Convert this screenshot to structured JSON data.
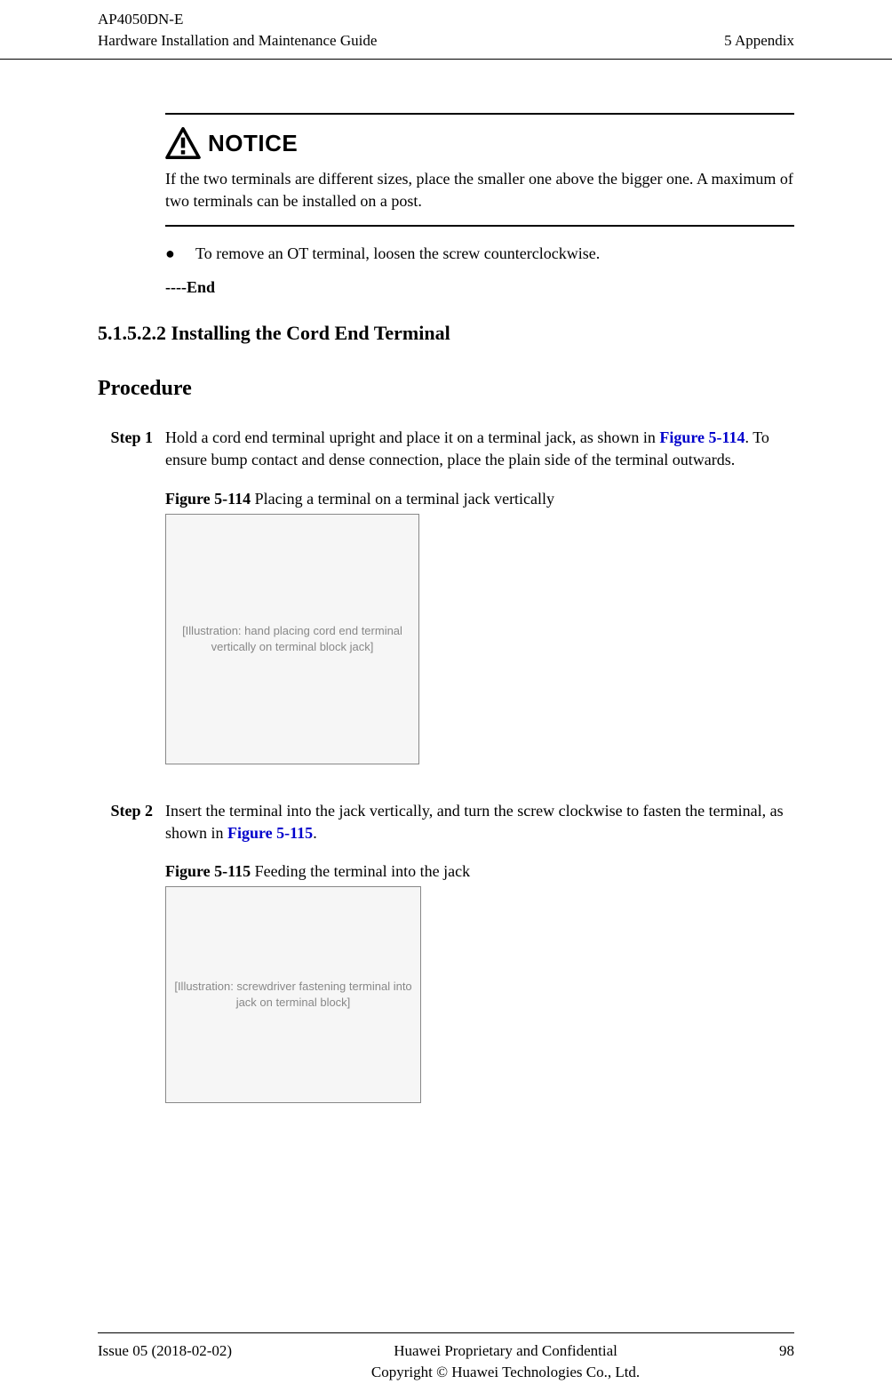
{
  "header": {
    "product": "AP4050DN-E",
    "doc_title": "Hardware Installation and Maintenance Guide",
    "chapter": "5 Appendix"
  },
  "notice": {
    "title": "NOTICE",
    "text": "If the two terminals are different sizes, place the smaller one above the bigger one. A maximum of two terminals can be installed on a post."
  },
  "bullet": {
    "text": "To remove an OT terminal, loosen the screw counterclockwise."
  },
  "end_marker": "----End",
  "section": {
    "number_title": "5.1.5.2.2 Installing the Cord End Terminal"
  },
  "procedure": {
    "heading": "Procedure",
    "step1": {
      "label": "Step 1",
      "text_before_link": "Hold a cord end terminal upright and place it on a terminal jack, as shown in ",
      "link": "Figure 5-114",
      "text_after_link": ". To ensure bump contact and dense connection, place the plain side of the terminal outwards."
    },
    "figure1": {
      "label": "Figure 5-114",
      "caption": " Placing a terminal on a terminal jack vertically",
      "alt": "[Illustration: hand placing cord end terminal vertically on terminal block jack]"
    },
    "step2": {
      "label": "Step 2",
      "text_before_link": "Insert the terminal into the jack vertically, and turn the screw clockwise to fasten the terminal, as shown in ",
      "link": "Figure 5-115",
      "text_after_link": "."
    },
    "figure2": {
      "label": "Figure 5-115",
      "caption": " Feeding the terminal into the jack",
      "alt": "[Illustration: screwdriver fastening terminal into jack on terminal block]"
    }
  },
  "footer": {
    "issue": "Issue 05 (2018-02-02)",
    "line1": "Huawei Proprietary and Confidential",
    "line2": "Copyright © Huawei Technologies Co., Ltd.",
    "page": "98"
  }
}
